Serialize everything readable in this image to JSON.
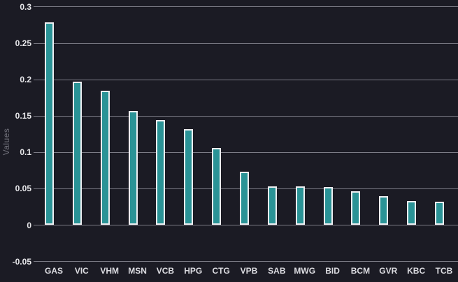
{
  "chart_data": {
    "type": "bar",
    "title": "",
    "xlabel": "",
    "ylabel": "Values",
    "categories": [
      "GAS",
      "VIC",
      "VHM",
      "MSN",
      "VCB",
      "HPG",
      "CTG",
      "VPB",
      "SAB",
      "MWG",
      "BID",
      "BCM",
      "GVR",
      "KBC",
      "TCB"
    ],
    "values": [
      0.279,
      0.197,
      0.185,
      0.157,
      0.144,
      0.132,
      0.106,
      0.073,
      0.053,
      0.053,
      0.052,
      0.047,
      0.04,
      0.033,
      0.032
    ],
    "yticks": [
      0.3,
      0.25,
      0.2,
      0.15,
      0.1,
      0.05,
      0,
      -0.05
    ],
    "ytick_labels": [
      "0.3",
      "0.25",
      "0.2",
      "0.15",
      "0.1",
      "0.05",
      "0",
      "-0.05"
    ],
    "ylim": [
      -0.05,
      0.3
    ],
    "grid": true,
    "legend_position": "none",
    "colors": {
      "background": "#1b1b24",
      "bar_fill": "#2a9396",
      "bar_stroke": "#eeeef1",
      "gridline": "#7c7c86",
      "ytick_label": "#e7e7ea",
      "xtick_label": "#dcdce1",
      "axis_title": "#70707a"
    }
  }
}
